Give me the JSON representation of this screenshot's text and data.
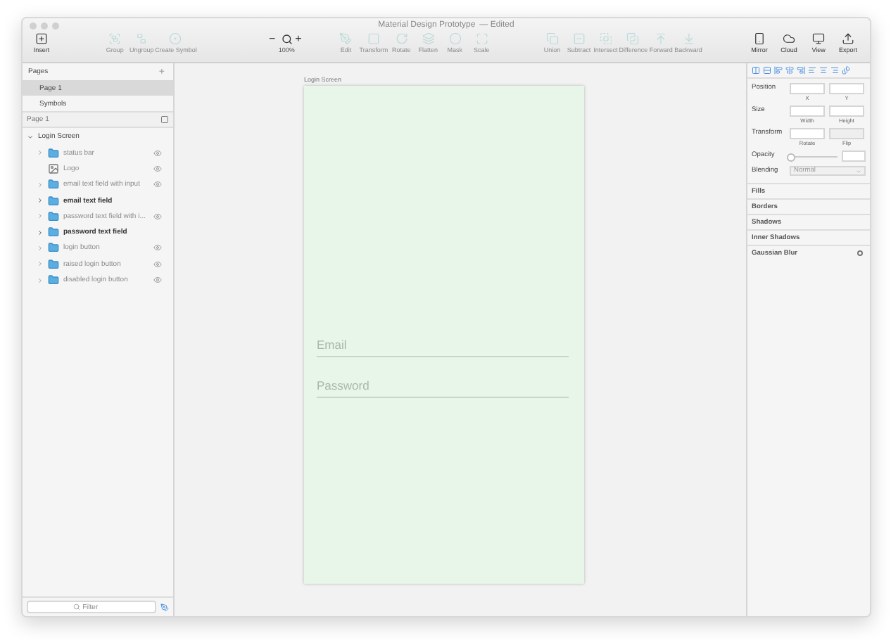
{
  "window": {
    "title": "Material Design Prototype",
    "status": "— Edited"
  },
  "toolbar": {
    "items": [
      {
        "label": "Insert",
        "disabled": false
      },
      {
        "label": "Group",
        "disabled": true
      },
      {
        "label": "Ungroup",
        "disabled": true
      },
      {
        "label": "Create Symbol",
        "disabled": true
      },
      {
        "label": "100%",
        "kind": "zoom",
        "minus": "−",
        "plus": "+"
      },
      {
        "label": "Edit",
        "disabled": true
      },
      {
        "label": "Transform",
        "disabled": true
      },
      {
        "label": "Rotate",
        "disabled": true
      },
      {
        "label": "Flatten",
        "disabled": true
      },
      {
        "label": "Mask",
        "disabled": true
      },
      {
        "label": "Scale",
        "disabled": true
      },
      {
        "label": "Union",
        "disabled": true
      },
      {
        "label": "Subtract",
        "disabled": true
      },
      {
        "label": "Intersect",
        "disabled": true
      },
      {
        "label": "Difference",
        "disabled": true
      },
      {
        "label": "Forward",
        "disabled": true
      },
      {
        "label": "Backward",
        "disabled": true
      },
      {
        "label": "Mirror",
        "disabled": false
      },
      {
        "label": "Cloud",
        "disabled": false
      },
      {
        "label": "View",
        "disabled": false
      },
      {
        "label": "Export",
        "disabled": false
      }
    ]
  },
  "sidebar": {
    "pages_title": "Pages",
    "add": "+",
    "pages": [
      {
        "label": "Page 1",
        "selected": true
      },
      {
        "label": "Symbols",
        "selected": false
      }
    ],
    "current_page": "Page 1",
    "artboard": {
      "label": "Login Screen",
      "expanded": true,
      "layers": [
        {
          "label": "status bar",
          "kind": "group",
          "bold": false
        },
        {
          "label": "Logo",
          "kind": "image",
          "bold": false
        },
        {
          "label": "email text field with input",
          "kind": "group",
          "bold": false
        },
        {
          "label": "email text field",
          "kind": "group",
          "bold": true
        },
        {
          "label": "password text field with i...",
          "kind": "group",
          "bold": false
        },
        {
          "label": "password text field",
          "kind": "group",
          "bold": true
        },
        {
          "label": "login button",
          "kind": "group",
          "bold": false
        },
        {
          "label": "raised login button",
          "kind": "group",
          "bold": false
        },
        {
          "label": "disabled login button",
          "kind": "group",
          "bold": false
        }
      ]
    },
    "filter": {
      "placeholder": "Filter"
    }
  },
  "canvas": {
    "artboard_title": "Login Screen",
    "fields": [
      {
        "placeholder": "Email"
      },
      {
        "placeholder": "Password"
      }
    ]
  },
  "inspector": {
    "rows": [
      {
        "kind": "pair",
        "label": "Position",
        "captions": [
          "X",
          "Y"
        ]
      },
      {
        "kind": "pair",
        "label": "Size",
        "captions": [
          "Width",
          "Height"
        ]
      },
      {
        "kind": "transform",
        "label": "Transform",
        "captions": [
          "Rotate",
          "Flip"
        ]
      },
      {
        "kind": "slider",
        "label": "Opacity",
        "level": 0
      },
      {
        "kind": "select",
        "label": "Blending",
        "value": "Normal"
      }
    ],
    "sections": [
      {
        "label": "Fills"
      },
      {
        "label": "Borders"
      },
      {
        "label": "Shadows"
      },
      {
        "label": "Inner Shadows"
      },
      {
        "label": "Gaussian Blur",
        "kind": "blur",
        "checked": false
      }
    ]
  }
}
